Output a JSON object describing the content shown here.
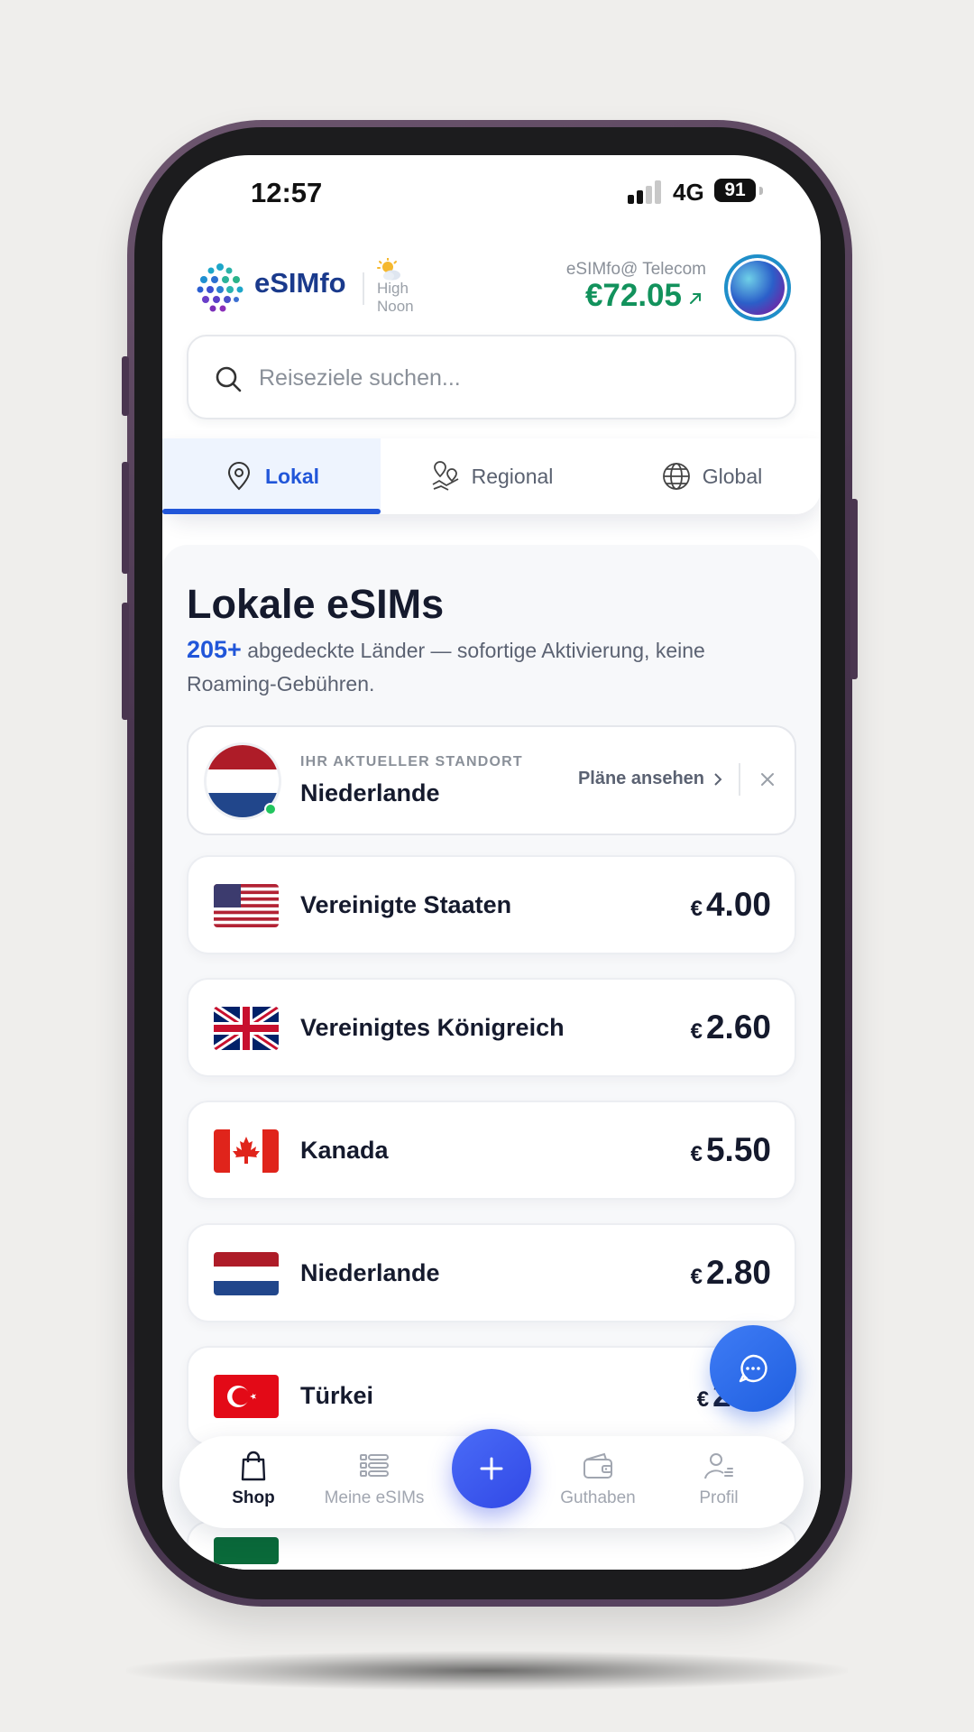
{
  "status_bar": {
    "time": "12:57",
    "network": "4G",
    "battery": "91"
  },
  "header": {
    "brand": "eSIMfo",
    "weather_line1": "High",
    "weather_line2": "Noon",
    "account_name": "eSIMfo@ Telecom",
    "balance": "€72.05"
  },
  "search": {
    "placeholder": "Reiseziele suchen..."
  },
  "tabs": [
    {
      "label": "Lokal",
      "icon": "map-pin-icon",
      "active": true
    },
    {
      "label": "Regional",
      "icon": "map-pins-icon",
      "active": false
    },
    {
      "label": "Global",
      "icon": "globe-icon",
      "active": false
    }
  ],
  "section": {
    "title": "Lokale eSIMs",
    "count": "205+",
    "subtitle": "abgedeckte Länder — sofortige Aktivierung, keine Roaming-Gebühren."
  },
  "current_location": {
    "label": "IHR AKTUELLER STANDORT",
    "country": "Niederlande",
    "link": "Pläne ansehen"
  },
  "countries": [
    {
      "name": "Vereinigte Staaten",
      "currency": "€",
      "price": "4.00",
      "flag": "us-flag"
    },
    {
      "name": "Vereinigtes Königreich",
      "currency": "€",
      "price": "2.60",
      "flag": "uk-flag"
    },
    {
      "name": "Kanada",
      "currency": "€",
      "price": "5.50",
      "flag": "canada-flag"
    },
    {
      "name": "Niederlande",
      "currency": "€",
      "price": "2.80",
      "flag": "netherlands-flag"
    },
    {
      "name": "Türkei",
      "currency": "€",
      "price": "2.",
      "flag": "turkey-flag"
    }
  ],
  "bottom_nav": [
    {
      "label": "Shop",
      "icon": "shopping-bag-icon",
      "active": true
    },
    {
      "label": "Meine eSIMs",
      "icon": "list-icon",
      "active": false
    },
    {
      "label": "Guthaben",
      "icon": "wallet-icon",
      "active": false
    },
    {
      "label": "Profil",
      "icon": "profile-icon",
      "active": false
    }
  ],
  "colors": {
    "accent": "#2156d9",
    "balance": "#12925c",
    "fab": "#3148e6"
  }
}
